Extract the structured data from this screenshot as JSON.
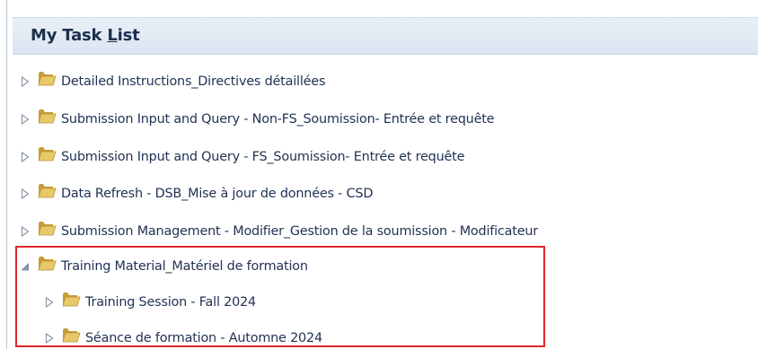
{
  "panel": {
    "title_before": "My Task ",
    "title_underlined": "L",
    "title_after": "ist"
  },
  "tree": {
    "items": [
      {
        "label": "Detailed Instructions_Directives détaillées",
        "state": "collapsed"
      },
      {
        "label": "Submission Input and Query - Non-FS_Soumission- Entrée et requête",
        "state": "collapsed"
      },
      {
        "label": "Submission Input and Query - FS_Soumission- Entrée et requête",
        "state": "collapsed"
      },
      {
        "label": "Data Refresh - DSB_Mise à jour de données - CSD",
        "state": "collapsed"
      },
      {
        "label": "Submission Management - Modifier_Gestion de la soumission - Modificateur",
        "state": "collapsed"
      },
      {
        "label": "Training Material_Matériel de formation",
        "state": "expanded"
      },
      {
        "label": "Training Session - Fall 2024",
        "state": "collapsed"
      },
      {
        "label": "Séance de formation - Automne 2024",
        "state": "collapsed"
      }
    ]
  },
  "colors": {
    "highlight_border": "#e0262b",
    "header_bg": "#dbe5f1",
    "text": "#1f3152",
    "folder": "#d8b44f"
  },
  "icons": {
    "collapsed": "triangle-right-icon",
    "expanded": "triangle-down-right-icon",
    "folder": "folder-icon"
  }
}
